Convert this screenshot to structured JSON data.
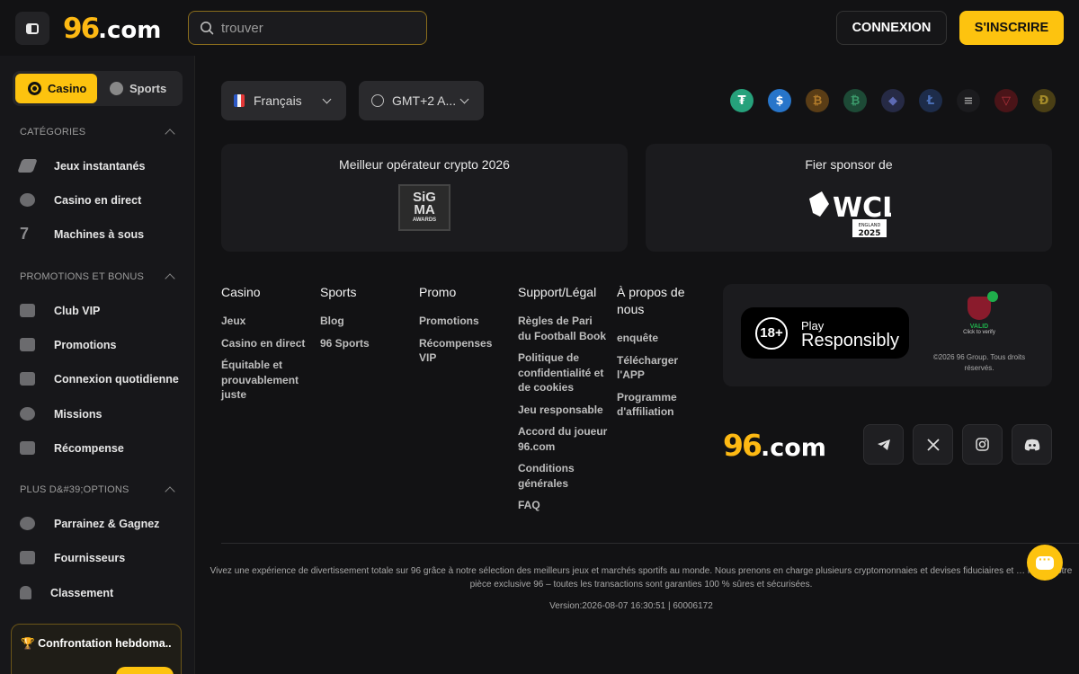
{
  "header": {
    "logo_number": "96",
    "logo_domain": ".com",
    "search_placeholder": "trouver",
    "login_label": "CONNEXION",
    "signup_label": "S'INSCRIRE"
  },
  "sidebar": {
    "mode_casino": "Casino",
    "mode_sports": "Sports",
    "section_categories": "CATÉGORIES",
    "categories": [
      "Jeux instantanés",
      "Casino en direct",
      "Machines à sous"
    ],
    "section_promotions": "PROMOTIONS ET BONUS",
    "promotions": [
      "Club VIP",
      "Promotions",
      "Connexion quotidienne",
      "Missions",
      "Récompense"
    ],
    "section_more": "PLUS D&#39;OPTIONS",
    "more": [
      "Parrainez & Gagnez",
      "Fournisseurs",
      "Classement"
    ],
    "promo_card_title": "Confrontation hebdoma..."
  },
  "main": {
    "language": "Français",
    "timezone": "GMT+2 A...",
    "coin_icons": [
      "tether-icon",
      "usdc-icon",
      "bitcoin-icon",
      "bitcoin-cash-icon",
      "ethereum-icon",
      "litecoin-icon",
      "solana-icon",
      "tron-icon",
      "dogecoin-icon"
    ],
    "award_left_caption": "Meilleur opérateur crypto 2026",
    "award_right_caption": "Fier sponsor de",
    "sigma_line1": "SiG",
    "sigma_line2": "MA",
    "sigma_line3": "AWARDS",
    "wcl_text": "WCL",
    "wcl_sub": "ENGLAND",
    "wcl_year": "2025"
  },
  "footer": {
    "columns": [
      {
        "heading": "Casino",
        "links": [
          "Jeux",
          "Casino en direct",
          "Équitable et prouvablement juste"
        ]
      },
      {
        "heading": "Sports",
        "links": [
          "Blog",
          "96 Sports"
        ]
      },
      {
        "heading": "Promo",
        "links": [
          "Promotions",
          "Récompenses VIP"
        ]
      },
      {
        "heading": "Support/Légal",
        "links": [
          "Règles de Pari du Football Book",
          "Politique de confidentialité et de cookies",
          "Jeu responsable",
          "Accord du joueur 96.com",
          "Conditions générales",
          "FAQ"
        ]
      },
      {
        "heading": "À propos de nous",
        "links": [
          "enquête",
          "Télécharger l'APP",
          "Programme d'affiliation"
        ]
      }
    ],
    "play_responsibly_line1": "Play",
    "play_responsibly_line2": "Responsibly",
    "badge_18": "18+",
    "valid_label": "VALID",
    "valid_sub": "Click to verify",
    "copyright": "©2026 96 Group. Tous droits réservés.",
    "social_icons": [
      "telegram-icon",
      "x-icon",
      "instagram-icon",
      "discord-icon"
    ],
    "disclaimer": "Vivez une expérience de divertissement totale sur 96 grâce à notre sélection des meilleurs jeux et marchés sportifs au monde. Nous prenons en charge plusieurs cryptomonnaies et devises fiduciaires et … lancé notre pièce exclusive 96 – toutes les transactions sont garanties 100 % sûres et sécurisées.",
    "version": "Version:2026-08-07 16:30:51  |  60006172"
  },
  "colors": {
    "accent": "#fdc30f",
    "background": "#121214",
    "panel": "#1b1b1e"
  }
}
